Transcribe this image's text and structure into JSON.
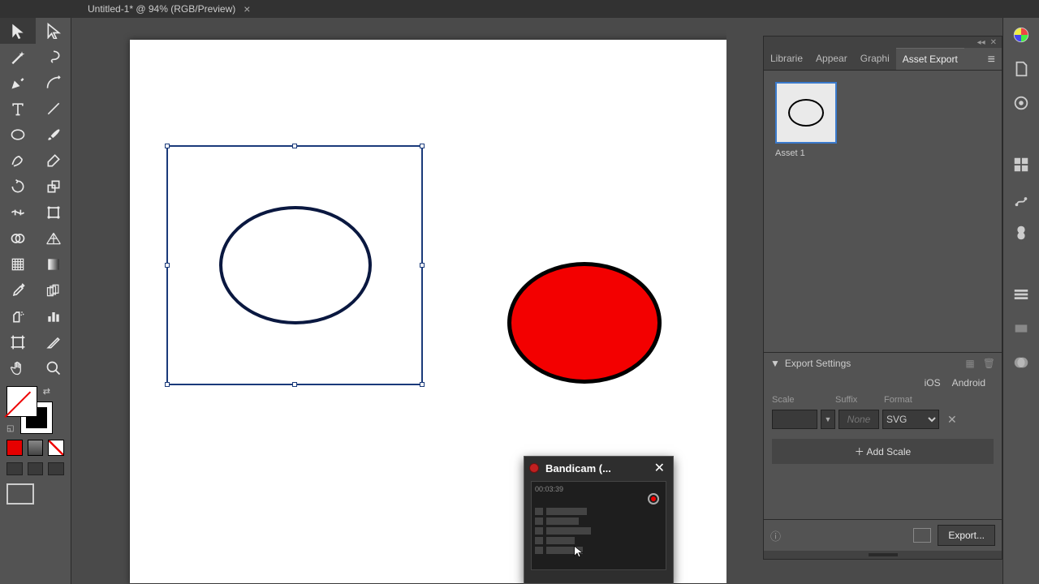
{
  "document": {
    "tab_title": "Untitled-1* @ 94% (RGB/Preview)"
  },
  "panel": {
    "tabs": [
      "Librarie",
      "Appear",
      "Graphi",
      "Asset Export"
    ],
    "active_tab": "Asset Export",
    "asset": {
      "name": "Asset 1"
    },
    "export_settings": {
      "title": "Export Settings",
      "platforms": [
        "iOS",
        "Android"
      ],
      "columns": {
        "scale": "Scale",
        "suffix": "Suffix",
        "format": "Format"
      },
      "row": {
        "scale": "",
        "suffix_placeholder": "None",
        "format": "SVG"
      },
      "add_scale": "Add Scale",
      "export_btn": "Export..."
    }
  },
  "popup": {
    "title": "Bandicam (...",
    "timer": "00:03:39"
  }
}
